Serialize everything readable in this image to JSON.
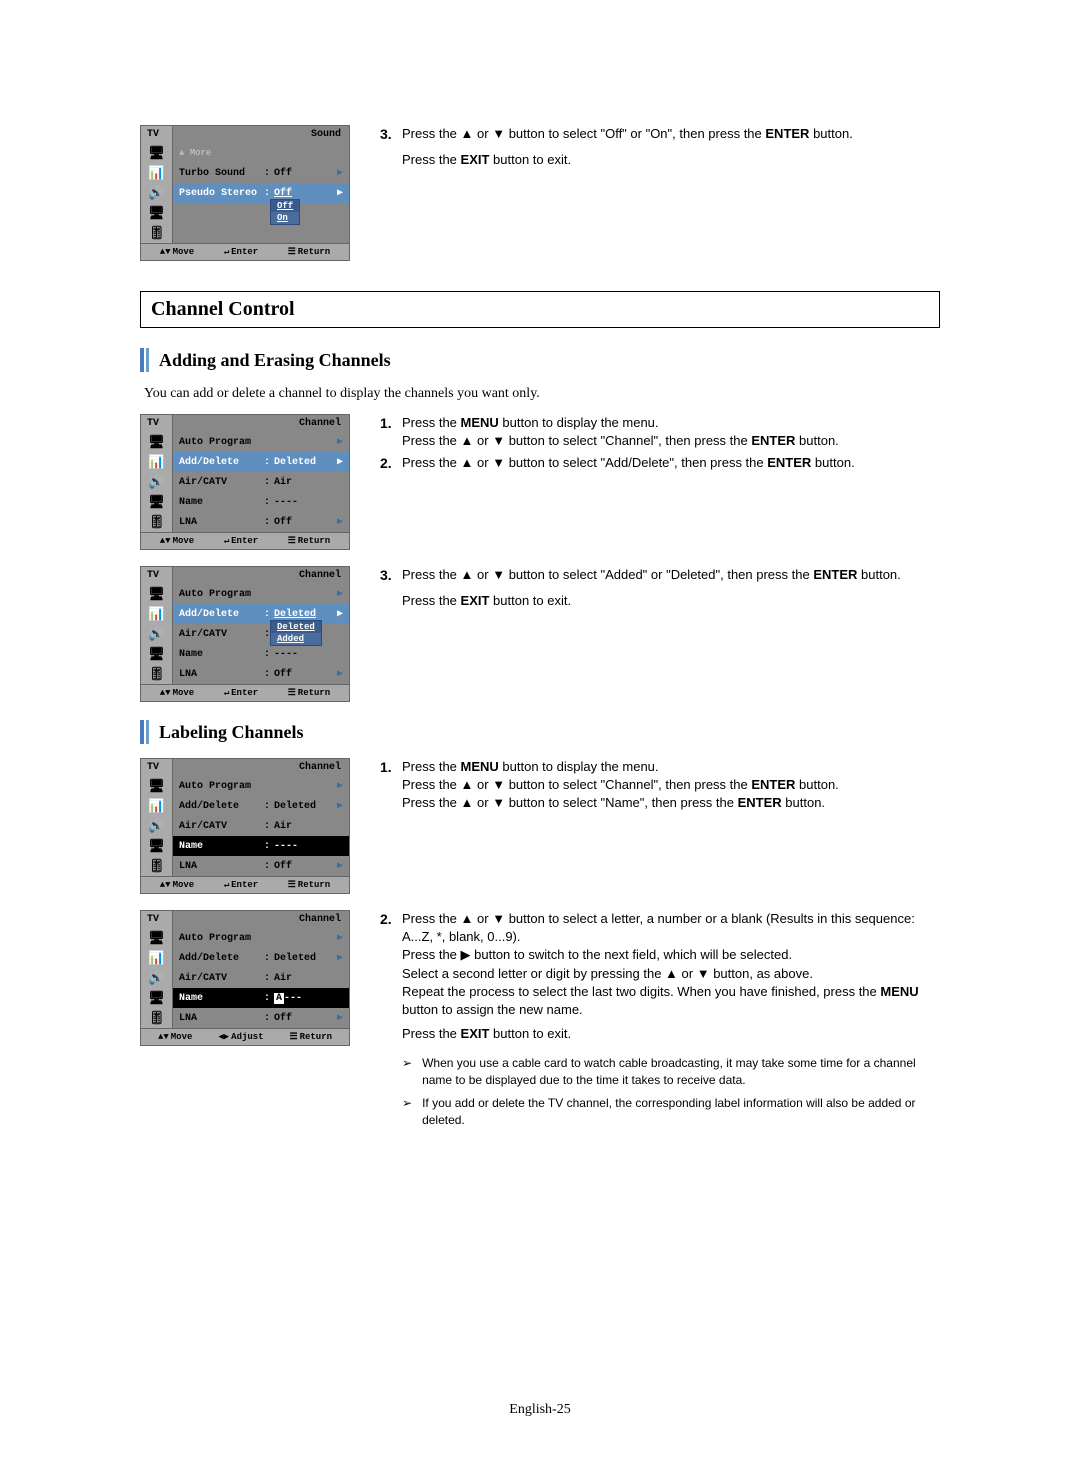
{
  "glyph": {
    "up": "▲",
    "down": "▼",
    "updown": "▲▼",
    "right": "▶",
    "left": "◀",
    "leftright": "◀▶",
    "enter": "↵",
    "menu": "☰",
    "tri": "➢"
  },
  "icons": {
    "tv": "🖥",
    "bars": "📊",
    "speaker": "🔊",
    "pc": "🖥",
    "sliders": "🎚"
  },
  "common": {
    "tv": "TV",
    "colon": ":",
    "move": "Move",
    "enter": "Enter",
    "return": "Return",
    "adjust": "Adjust"
  },
  "sound": {
    "title": "Sound",
    "more": "More",
    "rows": [
      {
        "label": "Turbo Sound",
        "value": "Off"
      },
      {
        "label": "Pseudo Stereo",
        "value": "Off"
      }
    ],
    "dropdown": [
      "Off",
      "On"
    ]
  },
  "topInstr3": {
    "num": "3.",
    "text_a": "Press the ",
    "text_b": " or ",
    "text_c": " button to select \"Off\" or \"On\", then press the ",
    "enter": "ENTER",
    "text_d": " button.",
    "exit_a": "Press the ",
    "exit_b": "EXIT",
    "exit_c": " button to exit."
  },
  "sectionTitle": "Channel Control",
  "sub1": "Adding and Erasing Channels",
  "sub1Intro": "You can add or delete a channel to display the channels you want only.",
  "channel": {
    "title": "Channel",
    "rows": [
      {
        "label": "Auto Program",
        "value": ""
      },
      {
        "label": "Add/Delete",
        "value": "Deleted"
      },
      {
        "label": "Air/CATV",
        "value": "Air"
      },
      {
        "label": "Name",
        "value": "----"
      },
      {
        "label": "LNA",
        "value": "Off"
      }
    ],
    "dropdown": [
      "Deleted",
      "Added"
    ],
    "nameEdit": {
      "char": "A",
      "rest": "---"
    }
  },
  "addInstr": {
    "i1": {
      "num": "1.",
      "a": "Press the ",
      "menu": "MENU",
      "b": " button to display the menu.",
      "c": "Press the ",
      "d": " or ",
      "e": " button to select \"Channel\", then press the ",
      "enter": "ENTER",
      "f": " button."
    },
    "i2": {
      "num": "2.",
      "a": "Press the ",
      "b": " or ",
      "c": " button to select \"Add/Delete\", then press the ",
      "enter": "ENTER",
      "d": " button."
    },
    "i3": {
      "num": "3.",
      "a": "Press the ",
      "b": " or ",
      "c": " button to select \"Added\" or \"Deleted\", then press the ",
      "enter": "ENTER",
      "d": " button.",
      "e": "Press the ",
      "exit": "EXIT",
      "f": " button to exit."
    }
  },
  "sub2": "Labeling Channels",
  "labelInstr": {
    "i1": {
      "num": "1.",
      "a": "Press the ",
      "menu": "MENU",
      "b": " button to display the menu.",
      "c": "Press the ",
      "d": " or ",
      "e": " button to select \"Channel\", then press the ",
      "enter": "ENTER",
      "f": " button.",
      "g": "Press the ",
      "h": " or ",
      "i": " button to select \"Name\", then press the ",
      "j": " button."
    },
    "i2": {
      "num": "2.",
      "a": "Press the ",
      "b": " or ",
      "c": " button to select a letter, a number or a blank (Results in this sequence: A...Z, *, blank, 0...9).",
      "d": "Press the ",
      "e": " button to switch to the next field, which will be selected.",
      "f": "Select a second letter or digit by pressing the ",
      "g": " or ",
      "h": " button, as above.",
      "i": "Repeat the process to select the last two digits. When you have finished, press the ",
      "menu": "MENU",
      "j": " button to assign the new name.",
      "k": "Press the ",
      "exit": "EXIT",
      "l": " button to exit."
    }
  },
  "notes": [
    "When you use a cable card to watch cable broadcasting, it may take some time for a channel name to be displayed due to the time it takes to receive data.",
    "If you add or delete the TV channel, the corresponding label information will also be added or deleted."
  ],
  "pageNum": "English-25"
}
